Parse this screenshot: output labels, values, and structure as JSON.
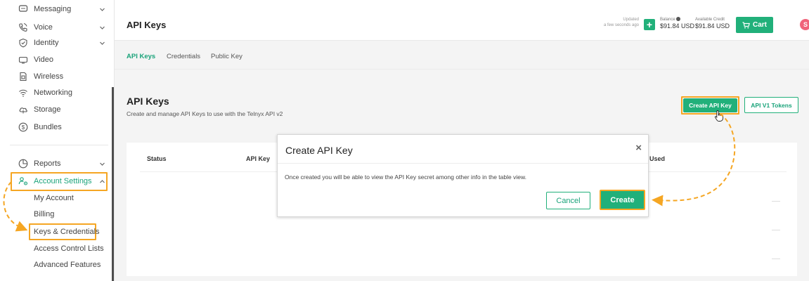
{
  "sidebar": {
    "items": [
      {
        "label": "Messaging",
        "icon": "message-icon",
        "chevron": true
      },
      {
        "label": "Voice",
        "icon": "phone-icon",
        "chevron": true
      },
      {
        "label": "Identity",
        "icon": "shield-check-icon",
        "chevron": true
      },
      {
        "label": "Video",
        "icon": "video-icon",
        "chevron": false
      },
      {
        "label": "Wireless",
        "icon": "sim-icon",
        "chevron": false
      },
      {
        "label": "Networking",
        "icon": "wifi-icon",
        "chevron": false
      },
      {
        "label": "Storage",
        "icon": "cloud-icon",
        "chevron": false
      },
      {
        "label": "Bundles",
        "icon": "dollar-circle-icon",
        "chevron": false
      }
    ],
    "reports_label": "Reports",
    "account_settings_label": "Account Settings",
    "sub_items": [
      "My Account",
      "Billing",
      "Keys & Credentials",
      "Access Control Lists",
      "Advanced Features"
    ]
  },
  "header": {
    "title": "API Keys",
    "updated_label": "Updated",
    "updated_time": "a few seconds ago",
    "balance_label": "Balance",
    "balance_value": "$91.84 USD",
    "credit_label": "Available Credit",
    "credit_value": "$91.84 USD",
    "cart_label": "Cart",
    "avatar_initial": "S"
  },
  "tabs": [
    "API Keys",
    "Credentials",
    "Public Key"
  ],
  "main": {
    "heading": "API Keys",
    "subtitle": "Create and manage API Keys to use with the Telnyx API v2",
    "create_key_button": "Create API Key",
    "v1_tokens_button": "API V1 Tokens",
    "table_headers": {
      "status": "Status",
      "api_key": "API Key",
      "last_used": "Used"
    }
  },
  "modal": {
    "title": "Create API Key",
    "close": "×",
    "body": "Once created you will be able to view the API Key secret among other info in the table view.",
    "cancel": "Cancel",
    "create": "Create"
  },
  "colors": {
    "accent": "#21b07a",
    "highlight": "#f5a623",
    "avatar": "#f0647a"
  }
}
